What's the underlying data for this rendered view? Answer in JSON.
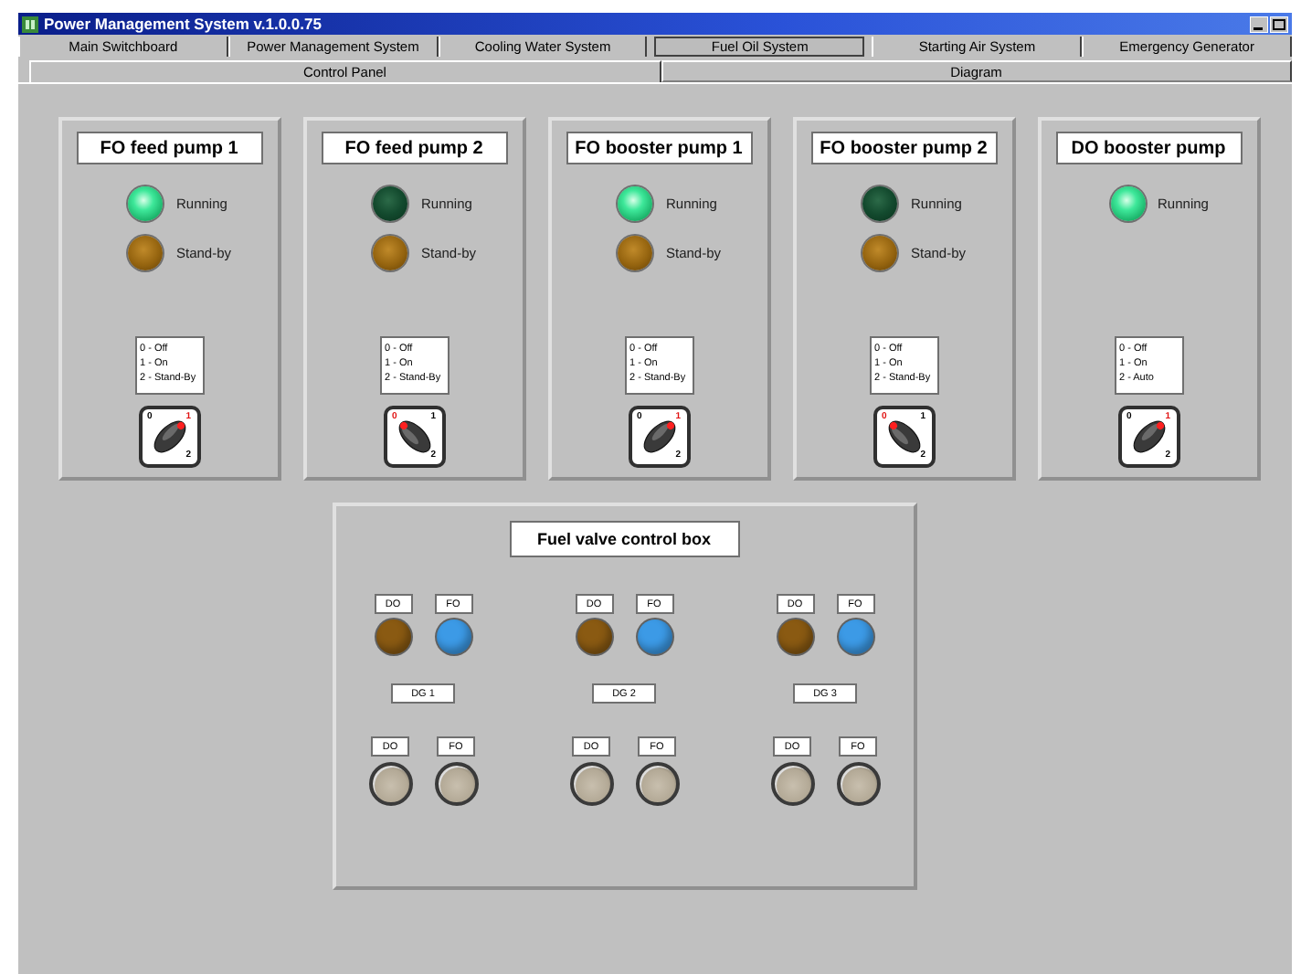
{
  "window": {
    "title": "Power Management System  v.1.0.0.75"
  },
  "tabs": [
    {
      "label": "Main Switchboard",
      "selected": false
    },
    {
      "label": "Power Management System",
      "selected": false
    },
    {
      "label": "Cooling Water System",
      "selected": false
    },
    {
      "label": "Fuel Oil System",
      "selected": true
    },
    {
      "label": "Starting Air System",
      "selected": false
    },
    {
      "label": "Emergency Generator",
      "selected": false
    }
  ],
  "subtabs": [
    {
      "label": "Control Panel",
      "selected": true
    },
    {
      "label": "Diagram",
      "selected": false
    }
  ],
  "pumps": [
    {
      "title": "FO feed pump 1",
      "lamps": [
        {
          "label": "Running",
          "kind": "running",
          "on": true
        },
        {
          "label": "Stand-by",
          "kind": "standby",
          "on": true
        }
      ],
      "legend": [
        "0 - Off",
        "1 - On",
        "2 - Stand-By"
      ],
      "positions": [
        {
          "label": "0",
          "selected": false
        },
        {
          "label": "1",
          "selected": true
        },
        {
          "label": "2",
          "selected": false
        }
      ]
    },
    {
      "title": "FO feed pump 2",
      "lamps": [
        {
          "label": "Running",
          "kind": "running",
          "on": false
        },
        {
          "label": "Stand-by",
          "kind": "standby",
          "on": true
        }
      ],
      "legend": [
        "0 - Off",
        "1 - On",
        "2 - Stand-By"
      ],
      "positions": [
        {
          "label": "0",
          "selected": true
        },
        {
          "label": "1",
          "selected": false
        },
        {
          "label": "2",
          "selected": false
        }
      ]
    },
    {
      "title": "FO booster pump 1",
      "lamps": [
        {
          "label": "Running",
          "kind": "running",
          "on": true
        },
        {
          "label": "Stand-by",
          "kind": "standby",
          "on": true
        }
      ],
      "legend": [
        "0 - Off",
        "1 - On",
        "2 - Stand-By"
      ],
      "positions": [
        {
          "label": "0",
          "selected": false
        },
        {
          "label": "1",
          "selected": true
        },
        {
          "label": "2",
          "selected": false
        }
      ]
    },
    {
      "title": "FO booster pump 2",
      "lamps": [
        {
          "label": "Running",
          "kind": "running",
          "on": false
        },
        {
          "label": "Stand-by",
          "kind": "standby",
          "on": true
        }
      ],
      "legend": [
        "0 - Off",
        "1 - On",
        "2 - Stand-By"
      ],
      "positions": [
        {
          "label": "0",
          "selected": true
        },
        {
          "label": "1",
          "selected": false
        },
        {
          "label": "2",
          "selected": false
        }
      ]
    },
    {
      "title": "DO booster pump",
      "lamps": [
        {
          "label": "Running",
          "kind": "running",
          "on": true
        }
      ],
      "legend": [
        "0 - Off",
        "1 - On",
        "2 - Auto"
      ],
      "positions": [
        {
          "label": "0",
          "selected": false
        },
        {
          "label": "1",
          "selected": true
        },
        {
          "label": "2",
          "selected": false
        }
      ]
    }
  ],
  "valve_box": {
    "title": "Fuel valve control box",
    "groups": [
      {
        "name": "DG 1",
        "indicators": [
          {
            "label": "DO",
            "color": "#8a5a12"
          },
          {
            "label": "FO",
            "color": "#3c9ae6"
          }
        ],
        "buttons": [
          "DO",
          "FO"
        ]
      },
      {
        "name": "DG 2",
        "indicators": [
          {
            "label": "DO",
            "color": "#8a5a12"
          },
          {
            "label": "FO",
            "color": "#3c9ae6"
          }
        ],
        "buttons": [
          "DO",
          "FO"
        ]
      },
      {
        "name": "DG 3",
        "indicators": [
          {
            "label": "DO",
            "color": "#8a5a12"
          },
          {
            "label": "FO",
            "color": "#3c9ae6"
          }
        ],
        "buttons": [
          "DO",
          "FO"
        ]
      }
    ]
  }
}
